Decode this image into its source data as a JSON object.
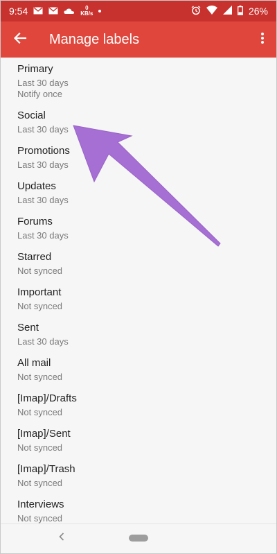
{
  "status_bar": {
    "time": "9:54",
    "net_speed_value": "0",
    "net_speed_unit": "KB/s",
    "battery": "26%"
  },
  "app_bar": {
    "title": "Manage labels",
    "back_icon": "arrow-back-icon",
    "more_icon": "more-vert-icon"
  },
  "labels": [
    {
      "name": "Primary",
      "sync": "Last 30 days",
      "notify": "Notify once"
    },
    {
      "name": "Social",
      "sync": "Last 30 days"
    },
    {
      "name": "Promotions",
      "sync": "Last 30 days"
    },
    {
      "name": "Updates",
      "sync": "Last 30 days"
    },
    {
      "name": "Forums",
      "sync": "Last 30 days"
    },
    {
      "name": "Starred",
      "sync": "Not synced"
    },
    {
      "name": "Important",
      "sync": "Not synced"
    },
    {
      "name": "Sent",
      "sync": "Last 30 days"
    },
    {
      "name": "All mail",
      "sync": "Not synced"
    },
    {
      "name": "[Imap]/Drafts",
      "sync": "Not synced"
    },
    {
      "name": "[Imap]/Sent",
      "sync": "Not synced"
    },
    {
      "name": "[Imap]/Trash",
      "sync": "Not synced"
    },
    {
      "name": "Interviews",
      "sync": "Not synced"
    }
  ],
  "colors": {
    "status_bar": "#c8322e",
    "app_bar": "#e0463b",
    "annotation_arrow": "#a66fd4"
  }
}
